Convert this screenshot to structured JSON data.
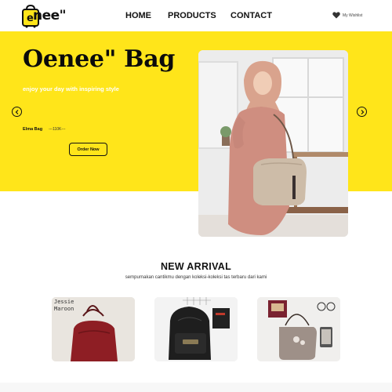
{
  "brand": {
    "logo_text": "nee\"",
    "logo_accent_letter": "e",
    "accent_color": "#ffe51a"
  },
  "nav": {
    "home": "HOME",
    "products": "PRODUCTS",
    "contact": "CONTACT"
  },
  "wishlist": {
    "label": "My Wishlist",
    "icon": "heart-icon"
  },
  "hero": {
    "title": "Oenee\" Bag",
    "subtitle": "enjoy your day with inspiring style",
    "product_name": "Elma Bag",
    "product_price": "---110K---",
    "cta_label": "Order Now",
    "prev_icon": "chevron-left-icon",
    "next_icon": "chevron-right-icon",
    "background": "#ffe51a"
  },
  "new_arrival": {
    "title": "NEW ARRIVAL",
    "subtitle": "sempurnakan cantikmu dengan koleksi-koleksi tas terbaru dari kami",
    "cards": [
      {
        "label": "Jessie\nMaroon"
      },
      {
        "label": ""
      },
      {
        "label": ""
      }
    ]
  }
}
